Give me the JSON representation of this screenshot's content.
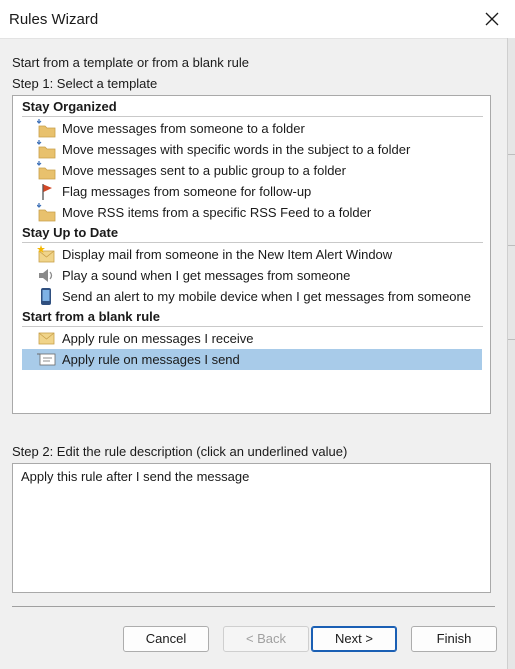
{
  "window": {
    "title": "Rules Wizard"
  },
  "intro": "Start from a template or from a blank rule",
  "step1": {
    "label": "Step 1: Select a template"
  },
  "groups": [
    {
      "header": "Stay Organized",
      "items": [
        {
          "label": "Move messages from someone to a folder",
          "icon": "folder-move-icon"
        },
        {
          "label": "Move messages with specific words in the subject to a folder",
          "icon": "folder-move-icon"
        },
        {
          "label": "Move messages sent to a public group to a folder",
          "icon": "folder-move-icon"
        },
        {
          "label": "Flag messages from someone for follow-up",
          "icon": "flag-icon"
        },
        {
          "label": "Move RSS items from a specific RSS Feed to a folder",
          "icon": "folder-move-icon"
        }
      ]
    },
    {
      "header": "Stay Up to Date",
      "items": [
        {
          "label": "Display mail from someone in the New Item Alert Window",
          "icon": "new-item-alert-icon"
        },
        {
          "label": "Play a sound when I get messages from someone",
          "icon": "speaker-icon"
        },
        {
          "label": "Send an alert to my mobile device when I get messages from someone",
          "icon": "mobile-phone-icon"
        }
      ]
    },
    {
      "header": "Start from a blank rule",
      "items": [
        {
          "label": "Apply rule on messages I receive",
          "icon": "envelope-icon"
        },
        {
          "label": "Apply rule on messages I send",
          "icon": "send-envelope-icon",
          "selected": true
        }
      ]
    }
  ],
  "step2": {
    "label": "Step 2: Edit the rule description (click an underlined value)",
    "description": "Apply this rule after I send the message"
  },
  "buttons": {
    "cancel": "Cancel",
    "back": "< Back",
    "next": "Next >",
    "finish": "Finish"
  },
  "colors": {
    "selection": "#a8cbe9",
    "flag": "#d24726",
    "folder": "#e8c16d",
    "accent": "#1a5fb4"
  }
}
